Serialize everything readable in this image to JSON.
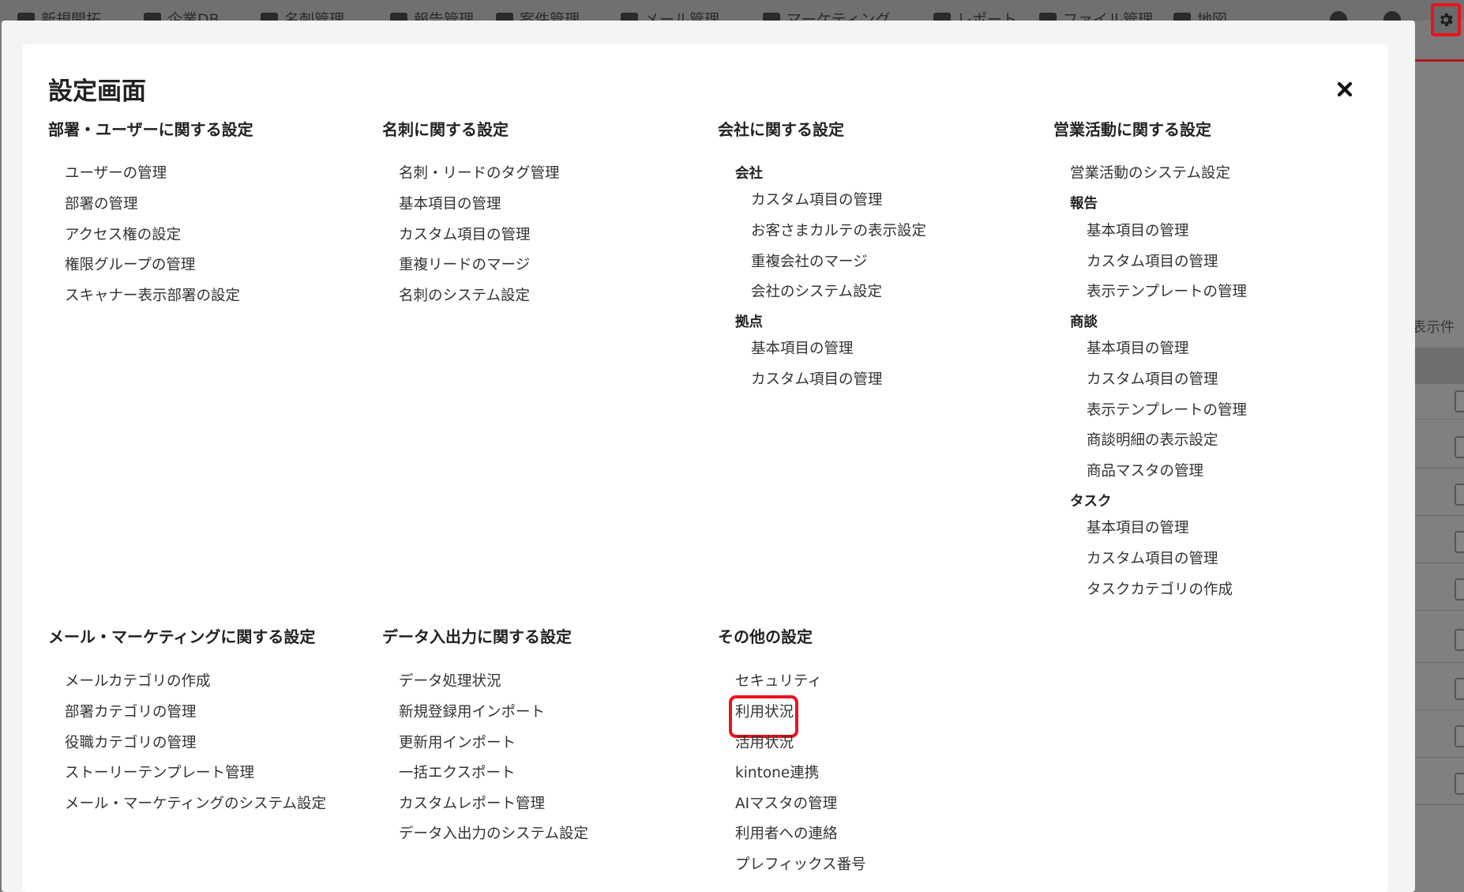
{
  "top_nav": {
    "items": [
      "新規開拓",
      "企業DB",
      "名刺管理",
      "報告管理",
      "案件管理",
      "メール管理",
      "マーケティング",
      "レポート",
      "ファイル管理",
      "地図"
    ]
  },
  "background": {
    "partial_text": "表示件"
  },
  "modal": {
    "title": "設定画面",
    "sections": {
      "dept_user": {
        "title": "部署・ユーザーに関する設定",
        "items": [
          "ユーザーの管理",
          "部署の管理",
          "アクセス権の設定",
          "権限グループの管理",
          "スキャナー表示部署の設定"
        ]
      },
      "business_card": {
        "title": "名刺に関する設定",
        "items": [
          "名刺・リードのタグ管理",
          "基本項目の管理",
          "カスタム項目の管理",
          "重複リードのマージ",
          "名刺のシステム設定"
        ]
      },
      "company": {
        "title": "会社に関する設定",
        "groups": [
          {
            "name": "会社",
            "items": [
              "カスタム項目の管理",
              "お客さまカルテの表示設定",
              "重複会社のマージ",
              "会社のシステム設定"
            ]
          },
          {
            "name": "拠点",
            "items": [
              "基本項目の管理",
              "カスタム項目の管理"
            ]
          }
        ]
      },
      "sales": {
        "title": "営業活動に関する設定",
        "top_item": "営業活動のシステム設定",
        "groups": [
          {
            "name": "報告",
            "items": [
              "基本項目の管理",
              "カスタム項目の管理",
              "表示テンプレートの管理"
            ]
          },
          {
            "name": "商談",
            "items": [
              "基本項目の管理",
              "カスタム項目の管理",
              "表示テンプレートの管理",
              "商談明細の表示設定",
              "商品マスタの管理"
            ]
          },
          {
            "name": "タスク",
            "items": [
              "基本項目の管理",
              "カスタム項目の管理",
              "タスクカテゴリの作成"
            ]
          }
        ]
      },
      "mail_marketing": {
        "title": "メール・マーケティングに関する設定",
        "items": [
          "メールカテゴリの作成",
          "部署カテゴリの管理",
          "役職カテゴリの管理",
          "ストーリーテンプレート管理",
          "メール・マーケティングのシステム設定"
        ]
      },
      "data_io": {
        "title": "データ入出力に関する設定",
        "items": [
          "データ処理状況",
          "新規登録用インポート",
          "更新用インポート",
          "一括エクスポート",
          "カスタムレポート管理",
          "データ入出力のシステム設定"
        ]
      },
      "other": {
        "title": "その他の設定",
        "items": [
          "セキュリティ",
          "利用状況",
          "活用状況",
          "kintone連携",
          "AIマスタの管理",
          "利用者への連絡",
          "プレフィックス番号"
        ]
      }
    }
  },
  "colors": {
    "highlight": "#e8141c",
    "overlay": "#7a7a7a",
    "text": "#333333"
  }
}
